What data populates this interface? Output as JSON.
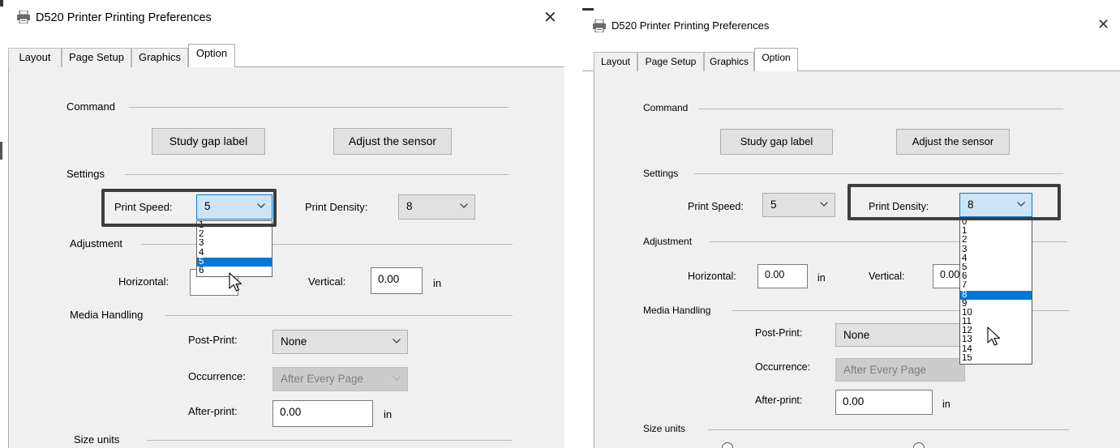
{
  "left_dialog": {
    "title": "D520 Printer Printing Preferences",
    "tabs": [
      {
        "label": "Layout"
      },
      {
        "label": "Page Setup"
      },
      {
        "label": "Graphics"
      },
      {
        "label": "Option"
      }
    ],
    "active_tab": "Option",
    "command_group": "Command",
    "study_gap_label_button": "Study gap label",
    "adjust_sensor_button": "Adjust the sensor",
    "settings_group": "Settings",
    "print_speed_label": "Print Speed:",
    "print_speed_value": "5",
    "print_speed_options": [
      "1",
      "2",
      "3",
      "4",
      "5",
      "6"
    ],
    "print_speed_selected": "5",
    "print_density_label": "Print Density:",
    "print_density_value": "8",
    "adjustment_group": "Adjustment",
    "horizontal_label": "Horizontal:",
    "vertical_label": "Vertical:",
    "vertical_value": "0.00",
    "vertical_unit": "in",
    "media_handling_group": "Media Handling",
    "post_print_label": "Post-Print:",
    "post_print_value": "None",
    "occurrence_label": "Occurrence:",
    "occurrence_value": "After Every Page",
    "after_print_label": "After-print:",
    "after_print_value": "0.00",
    "after_print_unit": "in",
    "size_units_group": "Size units"
  },
  "right_dialog": {
    "title": "D520 Printer Printing Preferences",
    "tabs": [
      {
        "label": "Layout"
      },
      {
        "label": "Page Setup"
      },
      {
        "label": "Graphics"
      },
      {
        "label": "Option"
      }
    ],
    "active_tab": "Option",
    "command_group": "Command",
    "study_gap_label_button": "Study gap label",
    "adjust_sensor_button": "Adjust the sensor",
    "settings_group": "Settings",
    "print_speed_label": "Print Speed:",
    "print_speed_value": "5",
    "print_density_label": "Print Density:",
    "print_density_value": "8",
    "print_density_options": [
      "0",
      "1",
      "2",
      "3",
      "4",
      "5",
      "6",
      "7",
      "8",
      "9",
      "10",
      "11",
      "12",
      "13",
      "14",
      "15"
    ],
    "print_density_selected": "8",
    "adjustment_group": "Adjustment",
    "horizontal_label": "Horizontal:",
    "horizontal_value": "0.00",
    "horizontal_unit": "in",
    "vertical_label": "Vertical:",
    "vertical_value": "0.00",
    "media_handling_group": "Media Handling",
    "post_print_label": "Post-Print:",
    "post_print_value": "None",
    "occurrence_label": "Occurrence:",
    "occurrence_value": "After Every Page",
    "after_print_label": "After-print:",
    "after_print_value": "0.00",
    "after_print_unit": "in",
    "size_units_group": "Size units"
  },
  "colors": {
    "panel_bg": "#f0f0f0",
    "selection_blue": "#0078d7",
    "focus_field_bg": "#cce4f7",
    "highlight_frame": "#3d3d3d"
  }
}
